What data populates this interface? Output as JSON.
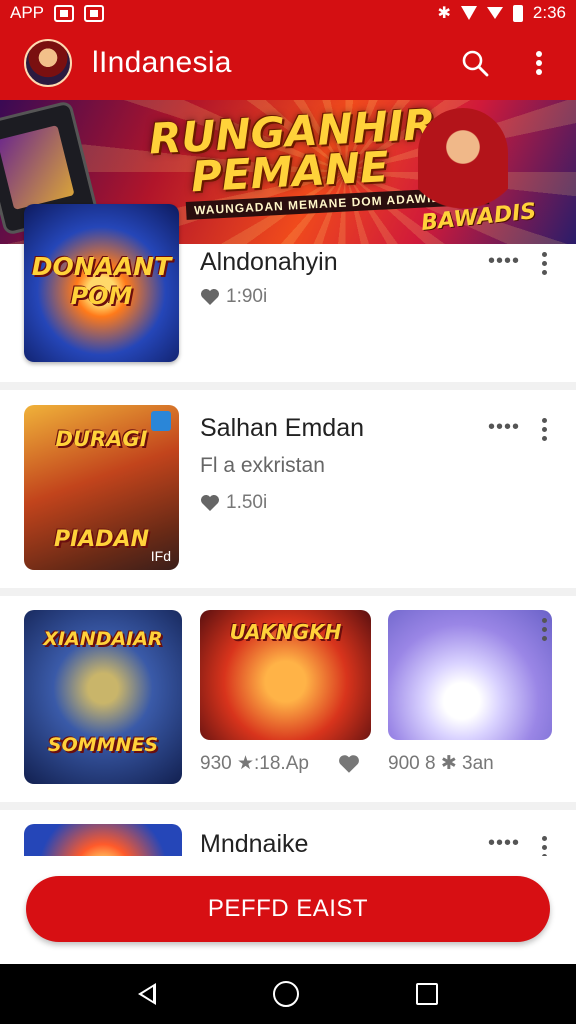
{
  "status_bar": {
    "app_label": "APP",
    "time": "2:36"
  },
  "app_bar": {
    "title": "lIndanesia",
    "icons": [
      "avatar",
      "search-icon",
      "more-vert-icon"
    ]
  },
  "banner": {
    "title_line1": "RUNGANHIR",
    "title_line2": "PEMANE",
    "subtitle": "WAUNGADAN MEMANE DOM ADAWILCAWO",
    "logo": "BAWADIS"
  },
  "items": [
    {
      "thumb_text_top": "DONAANT",
      "thumb_text_bottom": "POM",
      "title": "Alndonahyin",
      "meta": "1:90i"
    },
    {
      "thumb_text_top": "DURAGI",
      "thumb_text_bottom": "PIADAN",
      "thumb_corner": "IFd",
      "title": "Salhan Emdan",
      "subtitle": "Fl a exkristan",
      "meta": "1.50i"
    }
  ],
  "gallery": {
    "thumbs": [
      {
        "text_top": "XIANDAIAR",
        "text_bottom": "SOMMNES"
      },
      {
        "text_top": "UAKNGKH",
        "text_bottom": ""
      },
      {
        "text_top": "",
        "text_bottom": ""
      }
    ],
    "meta_left": "930 ★:18.Ap",
    "meta_right": "900 8 ✱ 3an"
  },
  "last_item": {
    "title": "Mndnaike"
  },
  "cta": {
    "label": "PEFFD EAIST"
  },
  "colors": {
    "primary": "#d40f12",
    "nav": "#000000"
  }
}
